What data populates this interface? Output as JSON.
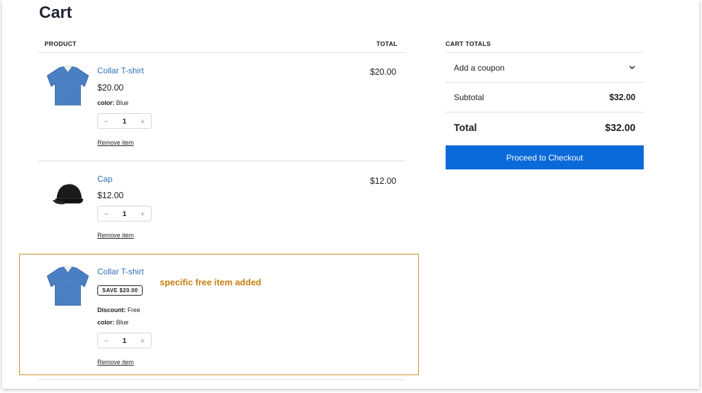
{
  "page": {
    "title": "Cart"
  },
  "table": {
    "product_header": "PRODUCT",
    "total_header": "TOTAL"
  },
  "items": [
    {
      "name": "Collar T-shirt",
      "price": "$20.00",
      "color_label": "color:",
      "color_value": "Blue",
      "quantity": "1",
      "remove_label": "Remove item",
      "line_total": "$20.00",
      "image_icon": "blue-collar-tshirt"
    },
    {
      "name": "Cap",
      "price": "$12.00",
      "quantity": "1",
      "remove_label": "Remove item",
      "line_total": "$12.00",
      "image_icon": "black-cap"
    },
    {
      "name": "Collar T-shirt",
      "badge": "SAVE $20.00",
      "discount_label": "Discount:",
      "discount_value": "Free",
      "color_label": "color:",
      "color_value": "Blue",
      "quantity": "1",
      "remove_label": "Remove item",
      "note": "specific free item added",
      "image_icon": "blue-collar-tshirt"
    }
  ],
  "totals": {
    "heading": "CART TOTALS",
    "coupon_label": "Add a coupon",
    "subtotal_label": "Subtotal",
    "subtotal_value": "$32.00",
    "total_label": "Total",
    "total_value": "$32.00",
    "checkout_label": "Proceed to Checkout"
  },
  "colors": {
    "link": "#2c6fb8",
    "checkout_bg": "#0b6ad9",
    "highlight_border": "#c8902a",
    "note_text": "#c47f0c"
  }
}
